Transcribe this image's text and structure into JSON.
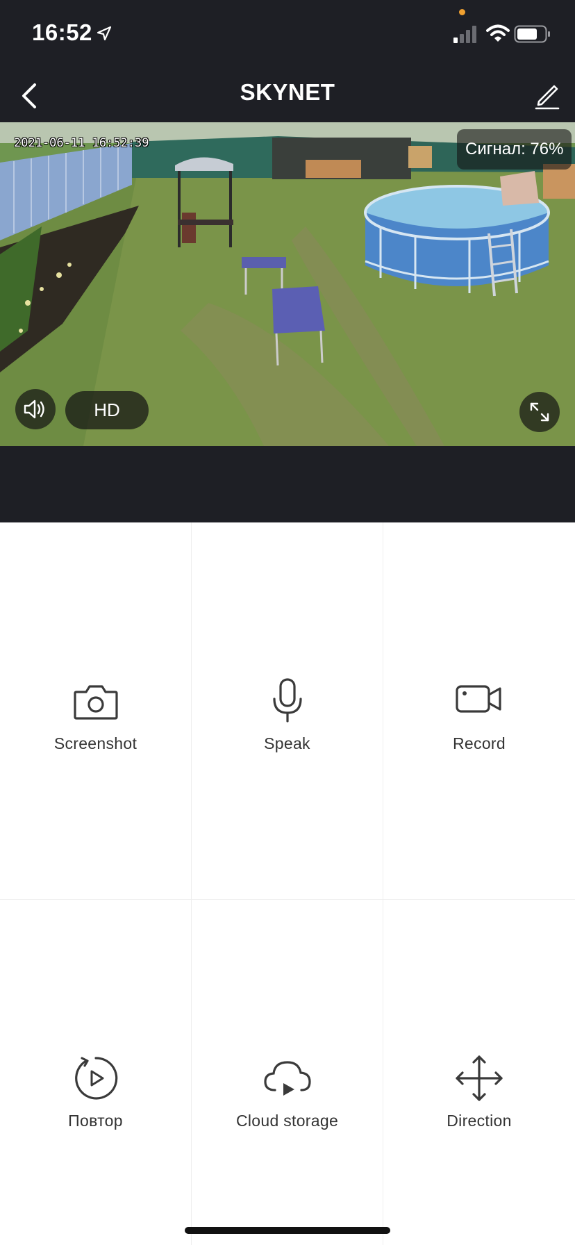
{
  "status_bar": {
    "time": "16:52",
    "location_icon": "location-arrow-icon",
    "signal_icon": "cellular-signal-icon",
    "wifi_icon": "wifi-icon",
    "battery_icon": "battery-icon"
  },
  "nav": {
    "title": "SKYNET",
    "back_icon": "chevron-left-icon",
    "edit_icon": "pencil-icon"
  },
  "video": {
    "timestamp": "2021-06-11 16:52:39",
    "signal_label": "Сигнал: 76%",
    "signal_percent": 76,
    "quality_label": "HD",
    "volume_icon": "speaker-icon",
    "fullscreen_icon": "expand-icon"
  },
  "actions": [
    {
      "label": "Screenshot",
      "icon": "camera-icon"
    },
    {
      "label": "Speak",
      "icon": "microphone-icon"
    },
    {
      "label": "Record",
      "icon": "video-camera-icon"
    },
    {
      "label": "Повтор",
      "icon": "playback-icon"
    },
    {
      "label": "Cloud storage",
      "icon": "cloud-play-icon"
    },
    {
      "label": "Direction",
      "icon": "move-arrows-icon"
    }
  ],
  "colors": {
    "header_bg": "#1e1f25",
    "panel_bg": "#ffffff",
    "icon_color": "#3a3a3a"
  }
}
